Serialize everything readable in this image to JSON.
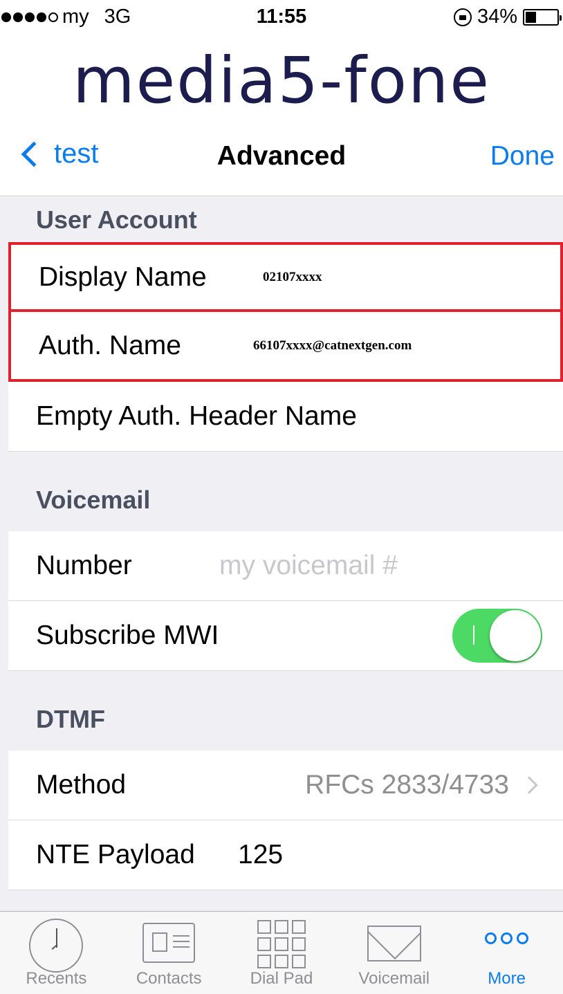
{
  "status_bar": {
    "carrier": "my",
    "network": "3G",
    "time": "11:55",
    "battery": "34%",
    "signal_bars_filled": 4,
    "signal_bars_total": 5,
    "battery_level": 0.34
  },
  "logo": "media5-fone",
  "nav": {
    "back_label": "test",
    "title": "Advanced",
    "done_label": "Done"
  },
  "sections": {
    "user_account": {
      "header": "User Account",
      "display_name": {
        "label": "Display Name",
        "value": "02107xxxx"
      },
      "auth_name": {
        "label": "Auth. Name",
        "value": "66107xxxx@catnextgen.com"
      },
      "empty_auth": {
        "label": "Empty Auth. Header Name"
      }
    },
    "voicemail": {
      "header": "Voicemail",
      "number": {
        "label": "Number",
        "placeholder": "my voicemail #"
      },
      "subscribe_mwi": {
        "label": "Subscribe MWI",
        "on": true
      }
    },
    "dtmf": {
      "header": "DTMF",
      "method": {
        "label": "Method",
        "value": "RFCs 2833/4733"
      },
      "nte_payload": {
        "label": "NTE Payload",
        "value": "125"
      }
    }
  },
  "tabs": [
    {
      "label": "Recents",
      "icon": "clock-icon"
    },
    {
      "label": "Contacts",
      "icon": "contacts-card-icon"
    },
    {
      "label": "Dial Pad",
      "icon": "dialpad-icon"
    },
    {
      "label": "Voicemail",
      "icon": "envelope-icon"
    },
    {
      "label": "More",
      "icon": "more-dots-icon",
      "active": true
    }
  ],
  "colors": {
    "accent": "#0a7cf0",
    "highlight_border": "#e0202c",
    "toggle_on": "#4cd964",
    "logo": "#1c1c4e"
  }
}
